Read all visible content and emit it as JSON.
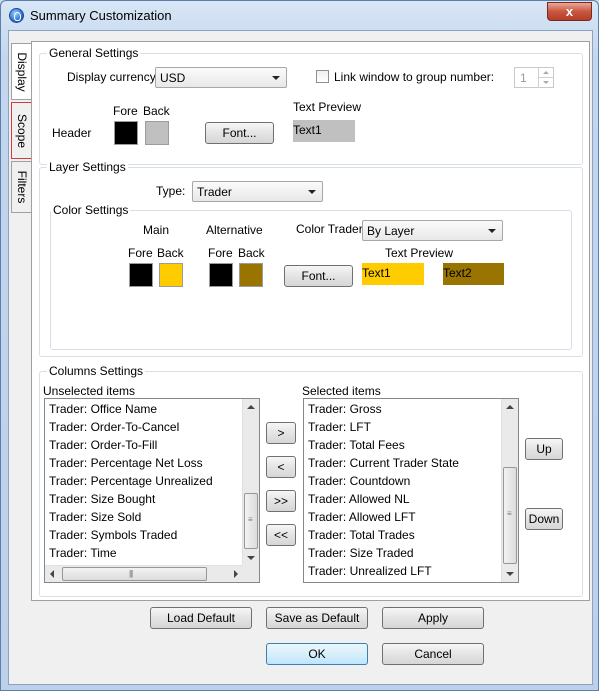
{
  "window": {
    "title": "Summary Customization",
    "close_glyph": "x"
  },
  "tabs": [
    {
      "label": "Display",
      "active": true
    },
    {
      "label": "Scope",
      "active": false
    },
    {
      "label": "Filters",
      "active": false
    }
  ],
  "general_settings": {
    "legend": "General Settings",
    "display_currency_label": "Display currency:",
    "display_currency_value": "USD",
    "link_window_label": "Link window to group number:",
    "link_window_checked": false,
    "group_number": "1",
    "fore_label": "Fore",
    "back_label": "Back",
    "header_label": "Header",
    "font_button": "Font...",
    "text_preview_label": "Text Preview",
    "text_preview_value": "Text1",
    "colors": {
      "fore": "#000000",
      "back": "#c0c0c0",
      "preview_bg": "#c0c0c0",
      "preview_fg": "#000000"
    }
  },
  "layer_settings": {
    "legend": "Layer Settings",
    "type_label": "Type:",
    "type_value": "Trader",
    "color_settings": {
      "legend": "Color Settings",
      "main_label": "Main",
      "alternative_label": "Alternative",
      "color_trader_label": "Color Trader:",
      "color_trader_value": "By Layer",
      "main_fore_label": "Fore",
      "main_back_label": "Back",
      "alt_fore_label": "Fore",
      "alt_back_label": "Back",
      "font_button": "Font...",
      "text_preview_label": "Text Preview",
      "text1": "Text1",
      "text2": "Text2",
      "colors": {
        "main_fore": "#000000",
        "main_back": "#ffcc00",
        "alt_fore": "#000000",
        "alt_back": "#9a7400",
        "text1_bg": "#ffcc00",
        "text2_bg": "#9a7400"
      }
    }
  },
  "columns_settings": {
    "legend": "Columns Settings",
    "unselected_label": "Unselected items",
    "selected_label": "Selected items",
    "unselected_items": [
      "Trader: Office Name",
      "Trader: Order-To-Cancel",
      "Trader: Order-To-Fill",
      "Trader: Percentage Net Loss",
      "Trader: Percentage Unrealized",
      "Trader: Size Bought",
      "Trader: Size Sold",
      "Trader: Symbols Traded",
      "Trader: Time"
    ],
    "selected_items": [
      "Trader: Gross",
      "Trader: LFT",
      "Trader: Total Fees",
      "Trader: Current Trader State",
      "Trader: Countdown",
      "Trader: Allowed NL",
      "Trader: Allowed LFT",
      "Trader: Total Trades",
      "Trader: Size Traded",
      "Trader: Unrealized LFT"
    ],
    "move_right": ">",
    "move_left": "<",
    "move_all_right": ">>",
    "move_all_left": "<<",
    "up_button": "Up",
    "down_button": "Down"
  },
  "footer": {
    "load_default": "Load Default",
    "save_as_default": "Save as Default",
    "apply": "Apply",
    "ok": "OK",
    "cancel": "Cancel"
  }
}
